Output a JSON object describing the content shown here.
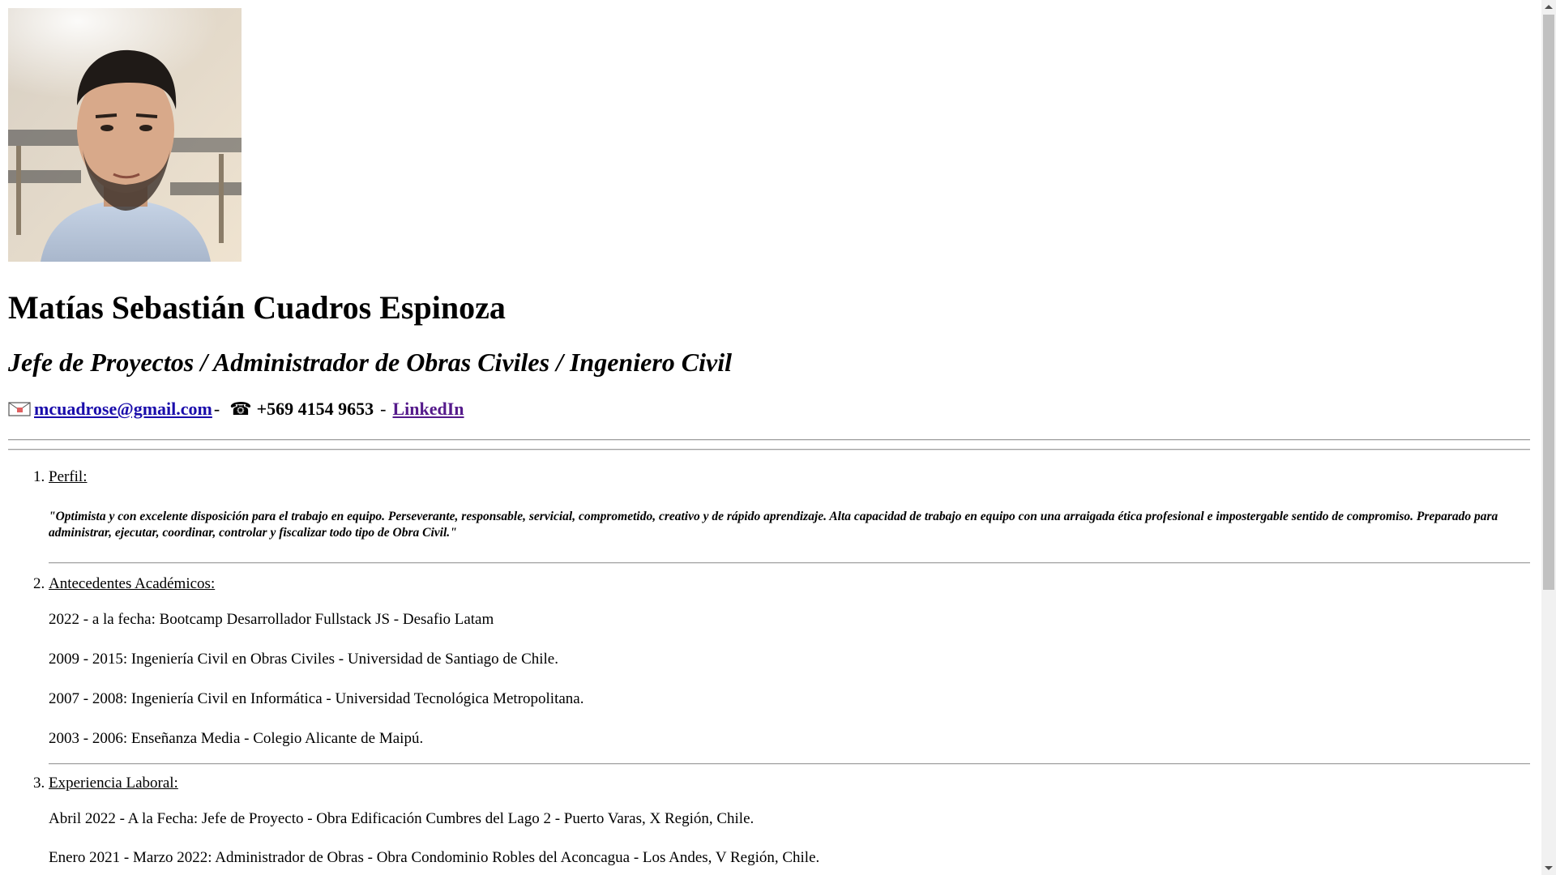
{
  "photo": {
    "alt": "Matías Sebastián Cuadros Espinoza"
  },
  "name": "Matías Sebastián Cuadros Espinoza",
  "role": "Jefe de Proyectos / Administrador de Obras Civiles / Ingeniero Civil",
  "contact": {
    "email": "mcuadrose@gmail.com",
    "separator1": "-",
    "phone_icon": "☎",
    "phone": "+569 4154 9653",
    "separator2": "-",
    "linkedin": "LinkedIn"
  },
  "sections": {
    "profile": {
      "title": "Perfil:",
      "text": "\"Optimista y con excelente disposición para el trabajo en equipo. Perseverante, responsable, servicial, comprometido, creativo y de rápido aprendizaje. Alta capacidad de trabajo en equipo con una arraigada ética profesional e impostergable sentido de compromiso. Preparado para administrar, ejecutar, coordinar, controlar y fiscalizar todo tipo de Obra Civil.\""
    },
    "academic": {
      "title": "Antecedentes Académicos:",
      "items": [
        "2022 - a la fecha: Bootcamp Desarrollador Fullstack JS - Desafio Latam",
        "2009 - 2015: Ingeniería Civil en Obras Civiles - Universidad de Santiago de Chile.",
        "2007 - 2008: Ingeniería Civil en Informática - Universidad Tecnológica Metropolitana.",
        "2003 - 2006: Enseñanza Media - Colegio Alicante de Maipú."
      ]
    },
    "experience": {
      "title": "Experiencia Laboral:",
      "items": [
        "Abril 2022 - A la Fecha: Jefe de Proyecto - Obra Edificación Cumbres del Lago 2 - Puerto Varas, X Región, Chile.",
        "Enero 2021 - Marzo 2022: Administrador de Obras - Obra Condominio Robles del Aconcagua - Los Andes, V Región, Chile."
      ]
    }
  }
}
